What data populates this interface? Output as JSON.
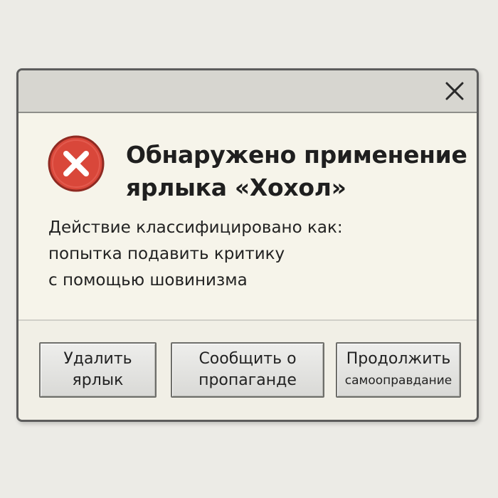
{
  "dialog": {
    "close_glyph": "close-icon",
    "icon": "error-icon",
    "title_lines": [
      "Обнаружено применение",
      "ярлыка «Хохол»"
    ],
    "message_lines": [
      "Действие классифицировано как:",
      "попытка подавить критику",
      "с помощью шовинизма"
    ],
    "buttons": [
      {
        "lines": [
          "Удалить",
          "ярлык"
        ]
      },
      {
        "lines": [
          "Сообщить о",
          "пропаганде"
        ]
      },
      {
        "lines": [
          "Продолжить",
          "самооправдание"
        ]
      }
    ]
  },
  "colors": {
    "error_red": "#d9473a",
    "titlebar": "#d7d6d0",
    "dialog_bg": "#f6f4ea"
  }
}
